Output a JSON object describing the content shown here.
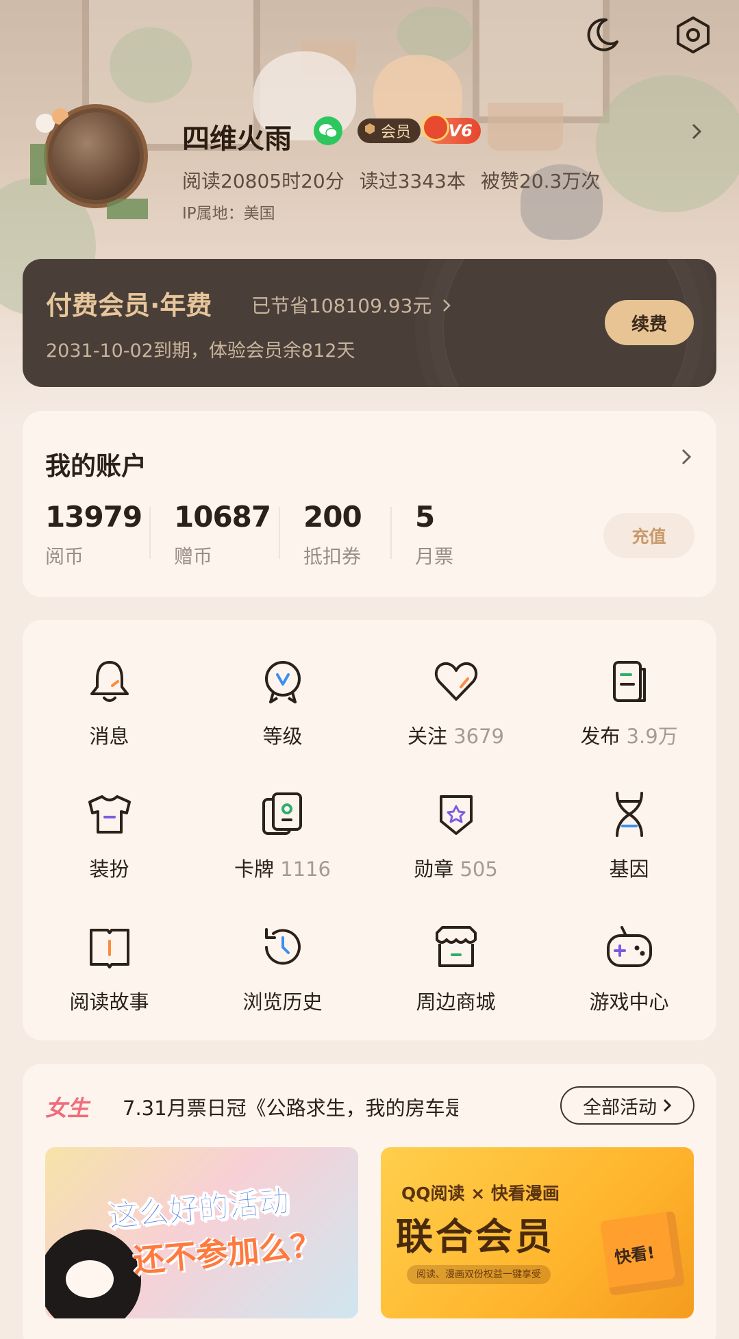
{
  "profile": {
    "username": "四维火雨",
    "vip_badge": "会员",
    "level_badge": "V6",
    "stats": {
      "reading_time": "阅读20805时20分",
      "books_read": "读过3343本",
      "likes": "被赞20.3万次"
    },
    "ip_location": "IP属地：美国"
  },
  "membership": {
    "title": "付费会员·年费",
    "saved": "已节省108109.93元",
    "expire": "2031-10-02到期，体验会员余812天",
    "renew_label": "续费"
  },
  "account": {
    "title": "我的账户",
    "items": [
      {
        "value": "13979",
        "label": "阅币"
      },
      {
        "value": "10687",
        "label": "赠币"
      },
      {
        "value": "200",
        "label": "抵扣券"
      },
      {
        "value": "5",
        "label": "月票"
      }
    ],
    "recharge_label": "充值"
  },
  "grid": [
    {
      "label": "消息",
      "count": "",
      "icon": "bell-icon"
    },
    {
      "label": "等级",
      "count": "",
      "icon": "level-medal-icon"
    },
    {
      "label": "关注",
      "count": "3679",
      "icon": "heart-icon"
    },
    {
      "label": "发布",
      "count": "3.9万",
      "icon": "publish-icon"
    },
    {
      "label": "装扮",
      "count": "",
      "icon": "tshirt-icon"
    },
    {
      "label": "卡牌",
      "count": "1116",
      "icon": "cards-icon"
    },
    {
      "label": "勋章",
      "count": "505",
      "icon": "badge-icon"
    },
    {
      "label": "基因",
      "count": "",
      "icon": "dna-icon"
    },
    {
      "label": "阅读故事",
      "count": "",
      "icon": "book-icon"
    },
    {
      "label": "浏览历史",
      "count": "",
      "icon": "history-clock-icon"
    },
    {
      "label": "周边商城",
      "count": "",
      "icon": "shop-icon"
    },
    {
      "label": "游戏中心",
      "count": "",
      "icon": "gamepad-icon"
    }
  ],
  "activity": {
    "tag": "女生",
    "headline": "7.31月票日冠《公路求生，我的房车是...",
    "all_label": "全部活动",
    "banner_left": {
      "line1": "这么好的活动",
      "line2": "还不参加么？"
    },
    "banner_right": {
      "line1": "QQ阅读 × 快看漫画",
      "line2": "联合会员",
      "line3": "阅读、漫画双份权益一键享受",
      "box_label": "快看!"
    }
  },
  "colors": {
    "accent_gold": "#e8c394",
    "card_dark": "#4a3f38",
    "muted_text": "#9a8d84",
    "wechat_green": "#2dc75d",
    "level_red": "#e6462e"
  }
}
